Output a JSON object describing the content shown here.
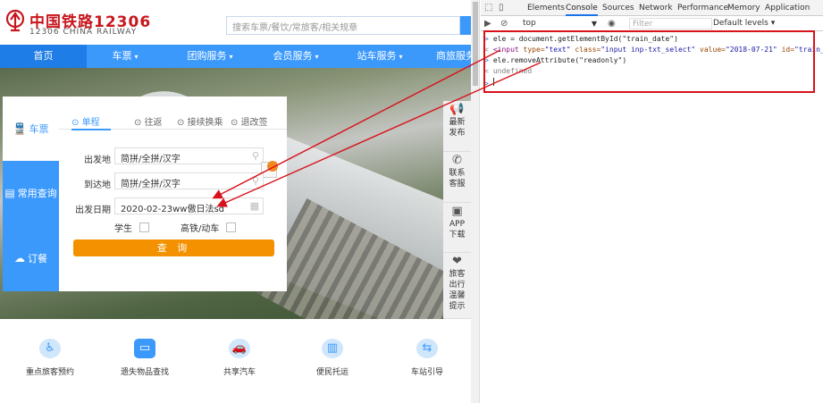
{
  "site": {
    "logo_cn": "中国铁路12306",
    "logo_en": "12306 CHINA RAILWAY",
    "search_placeholder": "搜索车票/餐饮/常旅客/相关规章",
    "nav": [
      "首页",
      "车票",
      "团购服务",
      "会员服务",
      "站车服务",
      "商旅服务"
    ],
    "sidebar": [
      "车票",
      "常用查询",
      "订餐"
    ],
    "tabs": [
      "单程",
      "往返",
      "接续换乘",
      "退改签"
    ],
    "form": {
      "from_label": "出发地",
      "from_value": "简拼/全拼/汉字",
      "to_label": "到达地",
      "to_value": "简拼/全拼/汉字",
      "date_label": "出发日期",
      "date_value": "2020-02-23ww傲日法sd",
      "student_label": "学生",
      "highspeed_label": "高铁/动车",
      "query_label": "查 询"
    },
    "float": [
      [
        "最新",
        "发布"
      ],
      [
        "联系",
        "客服"
      ],
      [
        "APP",
        "下载"
      ],
      [
        "旅客",
        "出行",
        "温馨",
        "提示"
      ]
    ],
    "services": [
      "重点旅客预约",
      "遗失物品查找",
      "共享汽车",
      "便民托运",
      "车站引导"
    ]
  },
  "devtools": {
    "tabs": [
      "Elements",
      "Console",
      "Sources",
      "Network",
      "Performance",
      "Memory",
      "Application"
    ],
    "active_tab": "Console",
    "context": "top",
    "filter_placeholder": "Filter",
    "levels": "Default levels ▾",
    "console": {
      "line1": "ele = document.getElementById(\"train_date\")",
      "line2_tag_open": "<input",
      "line2_a1": " type=",
      "line2_v1": "\"text\"",
      "line2_a2": " class=",
      "line2_v2": "\"input inp-txt_select\"",
      "line2_a3": " value=",
      "line2_v3": "\"2018-07-21\"",
      "line2_a4": " id=",
      "line2_v4": "\"train_date\"",
      "line2_tag_close": ">",
      "line3": "ele.removeAttribute(\"readonly\")",
      "line4": "undefined"
    }
  },
  "colors": {
    "brand_blue": "#3b99fc",
    "query_orange": "#f39100",
    "annotation_red": "#d8121b",
    "logo_red": "#c8161d"
  }
}
